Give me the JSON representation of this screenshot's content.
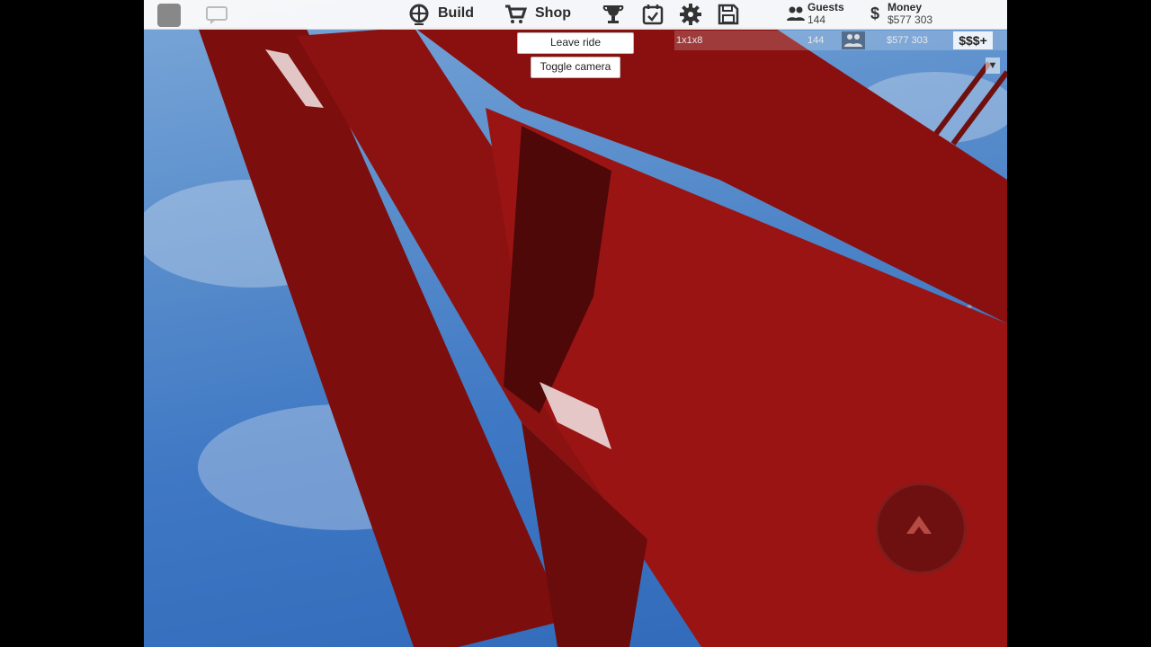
{
  "topbar": {
    "build_label": "Build",
    "shop_label": "Shop",
    "guests_title": "Guests",
    "guests_value": "144",
    "money_title": "Money",
    "money_value": "$577 303"
  },
  "strip": {
    "size_text": "1x1x8",
    "guests_value": "144",
    "money_value": "$577 303",
    "buy_money_label": "$$$+"
  },
  "ride_buttons": {
    "leave_ride": "Leave ride",
    "toggle_camera": "Toggle camera"
  },
  "colors": {
    "track_red": "#8c1212",
    "track_dark": "#4f0808",
    "sky": "#4a82c8",
    "topbar_bg": "#fafafa"
  },
  "icons": [
    "roblox-logo-icon",
    "chat-icon",
    "ferris-wheel-icon",
    "cart-icon",
    "trophy-icon",
    "calendar-check-icon",
    "gear-icon",
    "save-icon",
    "guests-icon",
    "dollar-icon",
    "jump-arrow-icon"
  ]
}
